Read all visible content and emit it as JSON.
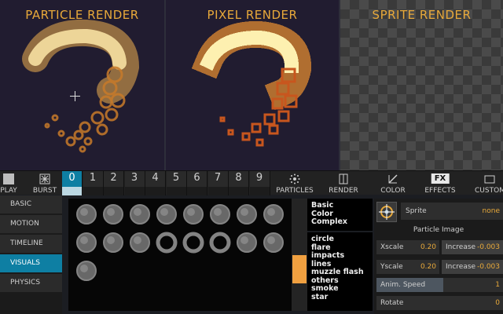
{
  "panels": {
    "particle_title": "PARTICLE RENDER",
    "pixel_title": "PIXEL RENDER",
    "sprite_title": "SPRITE RENDER"
  },
  "toolbar": {
    "play_label": "PLAY",
    "burst_label": "BURST",
    "slots": [
      "0",
      "1",
      "2",
      "3",
      "4",
      "5",
      "6",
      "7",
      "8",
      "9"
    ],
    "active_slot": "0",
    "particles_label": "PARTICLES",
    "render_label": "RENDER",
    "color_label": "COLOR",
    "fx_badge": "FX",
    "effects_label": "EFFECTS",
    "custom_label": "CUSTOM"
  },
  "sidebar": {
    "items": [
      "BASIC",
      "MOTION",
      "TIMELINE",
      "VISUALS",
      "PHYSICS"
    ],
    "active": "VISUALS"
  },
  "image_categories": {
    "groups": [
      "Basic",
      "Color",
      "Complex"
    ],
    "items": [
      "circle",
      "flare",
      "impacts",
      "lines",
      "muzzle flash",
      "others",
      "smoke",
      "star"
    ]
  },
  "properties": {
    "sprite_label": "Sprite",
    "sprite_value": "none",
    "section_title": "Particle Image",
    "xscale_label": "Xscale",
    "xscale_value": "0.20",
    "xincrease_label": "Increase",
    "xincrease_value": "-0.003",
    "yscale_label": "Yscale",
    "yscale_value": "0.20",
    "yincrease_label": "Increase",
    "yincrease_value": "-0.003",
    "anim_speed_label": "Anim. Speed",
    "anim_speed_value": "1",
    "rotate_label": "Rotate",
    "rotate_value": "0"
  },
  "colors": {
    "accent": "#0e7fa3",
    "title": "#e8a93a",
    "panel_bg": "#211c30",
    "value": "#e8a93a"
  }
}
